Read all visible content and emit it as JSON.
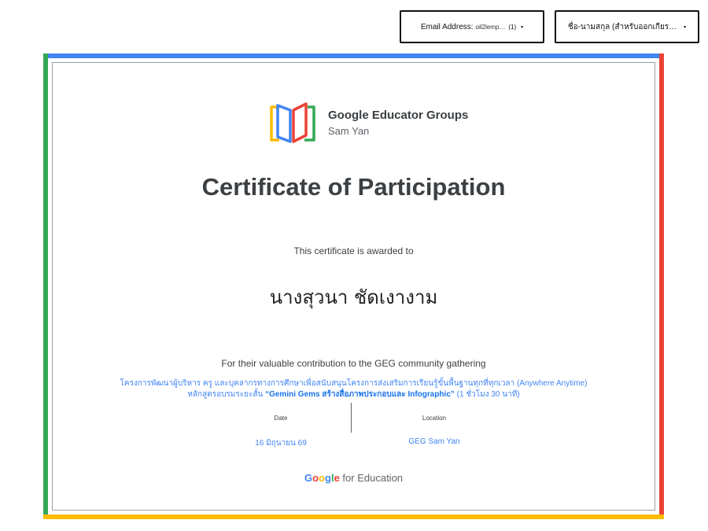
{
  "filters": {
    "email": {
      "label": "Email Address:",
      "value": "oil2lemp…",
      "count": "(1)",
      "caret": "▾"
    },
    "name": {
      "label": "ชื่อ-นามสกุล (สำหรับออกเกียร…",
      "caret": "▾"
    }
  },
  "certificate": {
    "org_name": "Google Educator Groups",
    "chapter": "Sam Yan",
    "title": "Certificate of Participation",
    "awarded_text": "This certificate is awarded to",
    "recipient": "นางสุวนา ชัดเงางาม",
    "contribution": "For their valuable contribution to the GEG community gathering",
    "program_line1": "โครงการพัฒนาผู้บริหาร ครู และบุคลากรทางการศึกษาเพื่อสนับสนุนโครงการส่งเสริมการเรียนรู้ขั้นพื้นฐานทุกที่ทุกเวลา (Anywhere Anytime)",
    "program_line2_prefix": "หลักสูตรอบรมระยะสั้น",
    "program_line2_bold": "“Gemini Gems สร้างสื่อภาพประกอบและ Infographic”",
    "program_line2_suffix": "(1 ชั่วโมง 30 นาที)",
    "date_label": "Date",
    "date_value": "16 มิถุนายน 69",
    "location_label": "Location",
    "location_value": "GEG Sam Yan",
    "footer_g": [
      "G",
      "o",
      "o",
      "g",
      "l",
      "e"
    ],
    "footer_suffix": "for Education"
  },
  "colors": {
    "blue": "#4285f4",
    "red": "#ea4335",
    "yellow": "#fbbc04",
    "green": "#34a853"
  },
  "icons": {
    "logo": "geg-book-icon",
    "caret": "chevron-down-icon"
  }
}
